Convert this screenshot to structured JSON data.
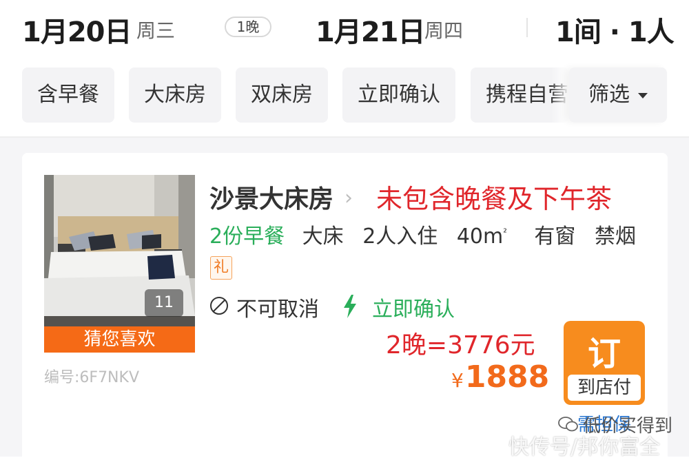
{
  "date_bar": {
    "checkin_date": "1月20日",
    "checkin_weekday": "周三",
    "nights": "1晚",
    "checkout_date": "1月21日",
    "checkout_weekday": "周四",
    "rooms_guests": "1间 · 1人"
  },
  "filters": {
    "chips": [
      "含早餐",
      "大床房",
      "双床房",
      "立即确认",
      "携程自营"
    ],
    "filter_label": "筛选"
  },
  "room": {
    "photo_count": "11",
    "photo_tag": "猜您喜欢",
    "code": "编号:6F7NKV",
    "name": "沙景大床房",
    "promo": "未包含晚餐及下午茶",
    "breakfast": "2份早餐",
    "bed": "大床",
    "occupancy": "2人入住",
    "area": "40m",
    "area_unit": "²",
    "window": "有窗",
    "smoking": "禁烟",
    "gift_badge": "礼",
    "cancel_policy": "不可取消",
    "confirm": "立即确认",
    "total": "2晚=3776元",
    "price_symbol": "¥",
    "price": "1888",
    "book_label": "订",
    "pay_label": "到店付",
    "guarantee": "需担保"
  },
  "watermark": {
    "line1": "低价买得到",
    "line2": "快传号/邦你富全"
  },
  "colors": {
    "accent_orange": "#f78c1e",
    "price_red": "#e0262b",
    "green": "#2aae5a",
    "link_blue": "#2b78d2"
  }
}
